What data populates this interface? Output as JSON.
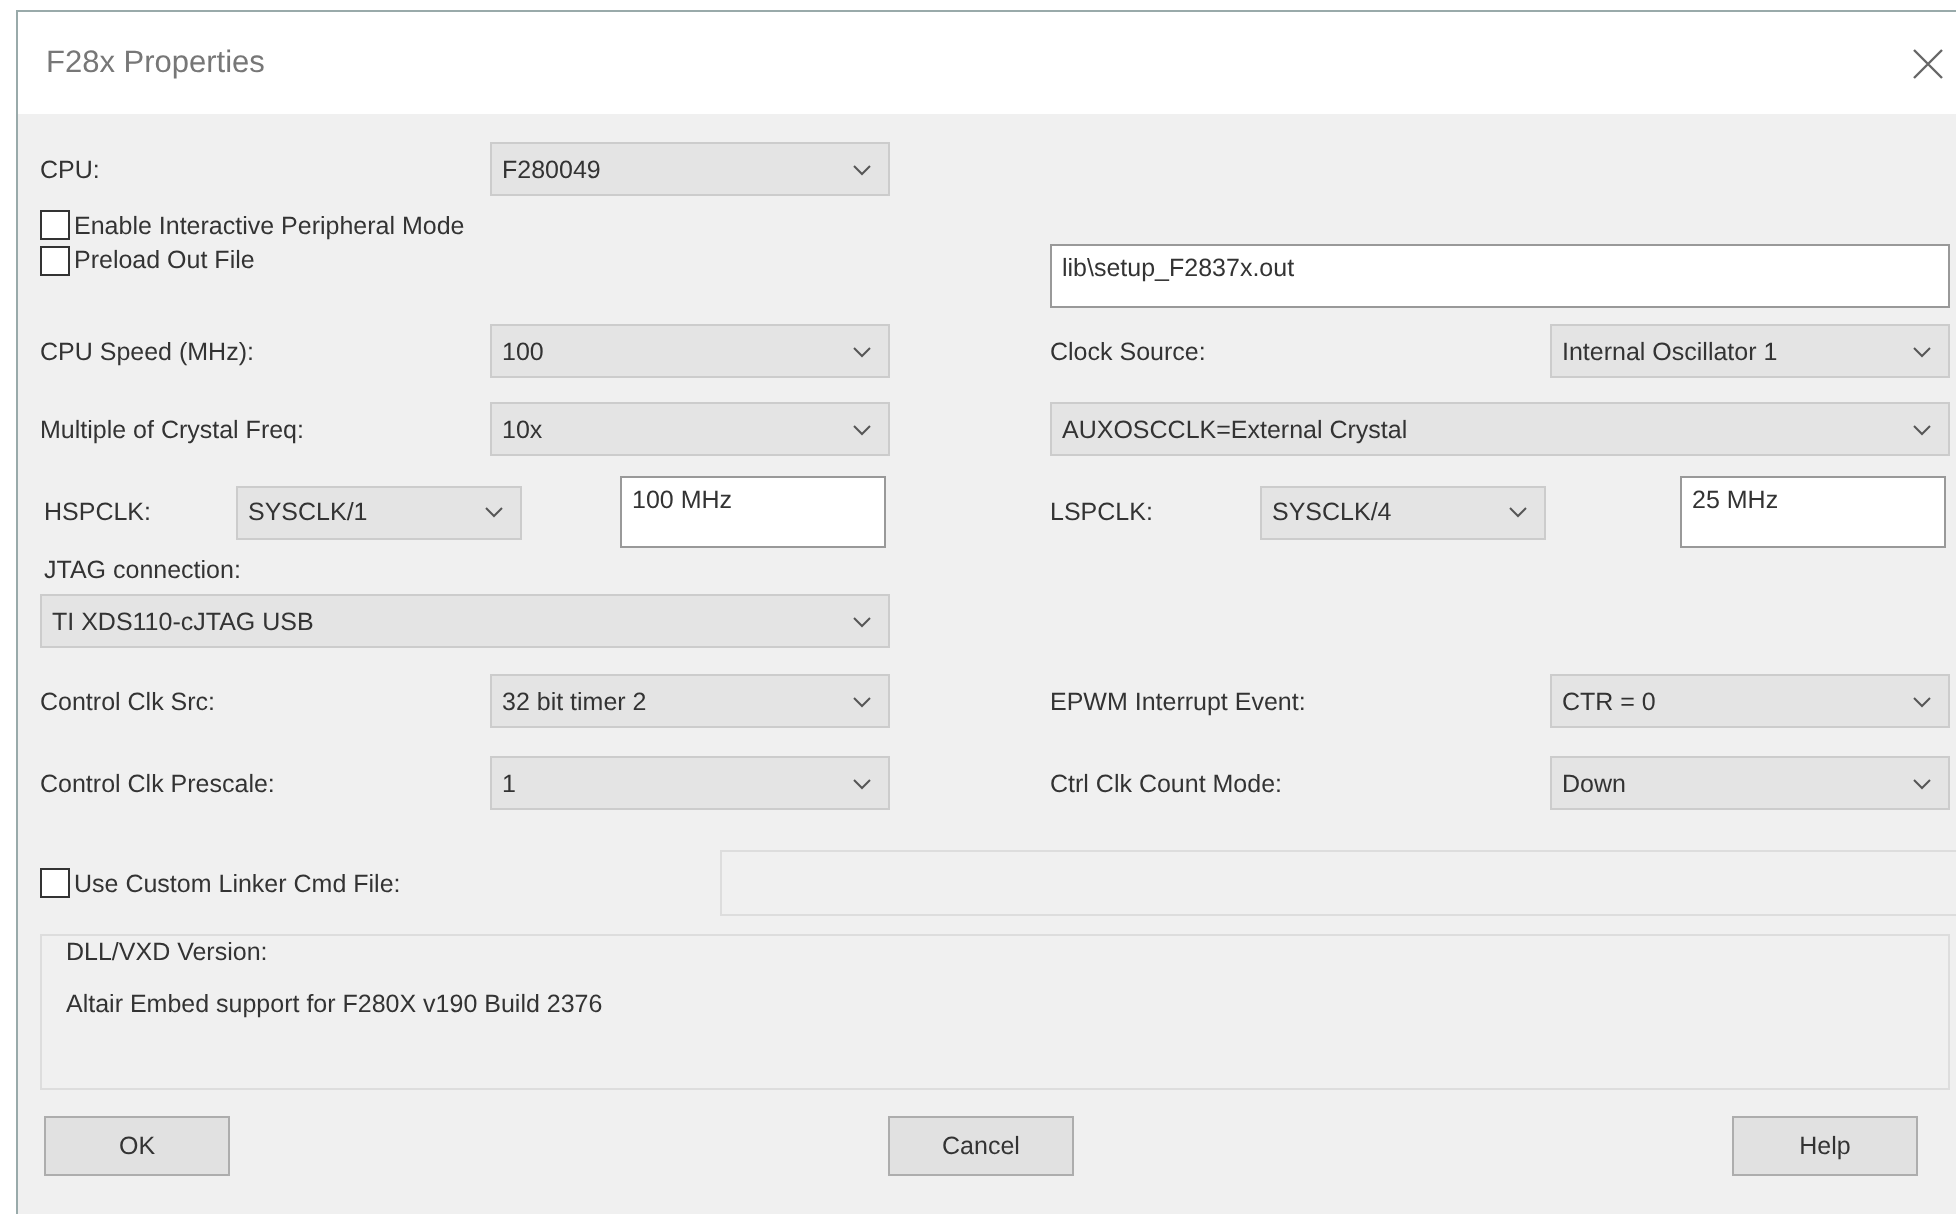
{
  "window": {
    "title": "F28x Properties"
  },
  "cpu": {
    "label": "CPU:",
    "value": "F280049"
  },
  "interactive_mode": {
    "label": "Enable Interactive Peripheral Mode",
    "checked": false
  },
  "preload": {
    "label": "Preload Out File",
    "checked": false,
    "path": "lib\\setup_F2837x.out"
  },
  "cpu_speed": {
    "label": "CPU Speed (MHz):",
    "value": "100"
  },
  "clock_source": {
    "label": "Clock Source:",
    "value": "Internal Oscillator 1"
  },
  "crystal_multiple": {
    "label": "Multiple of Crystal Freq:",
    "value": "10x"
  },
  "aux_clock": {
    "value": "AUXOSCCLK=External Crystal"
  },
  "hspclk": {
    "label": "HSPCLK:",
    "divider": "SYSCLK/1",
    "frequency": "100 MHz"
  },
  "lspclk": {
    "label": "LSPCLK:",
    "divider": "SYSCLK/4",
    "frequency": "25 MHz"
  },
  "jtag": {
    "label": "JTAG connection:",
    "value": "TI XDS110-cJTAG USB"
  },
  "control_clk_src": {
    "label": "Control Clk Src:",
    "value": "32 bit timer 2"
  },
  "epwm_event": {
    "label": "EPWM Interrupt Event:",
    "value": "CTR = 0"
  },
  "control_clk_prescale": {
    "label": "Control Clk Prescale:",
    "value": "1"
  },
  "count_mode": {
    "label": "Ctrl Clk Count Mode:",
    "value": "Down"
  },
  "linker": {
    "label": "Use Custom Linker Cmd File:",
    "checked": false
  },
  "version": {
    "title": "DLL/VXD Version:",
    "text": "Altair Embed support for F280X v190 Build 2376"
  },
  "buttons": [
    "OK",
    "Cancel",
    "Help"
  ]
}
